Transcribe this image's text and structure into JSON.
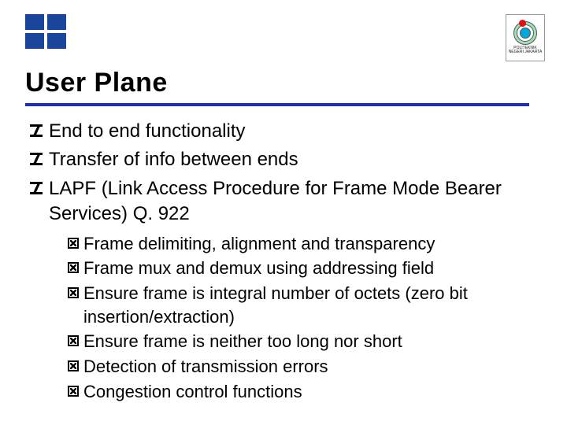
{
  "title": "User Plane",
  "logo_right_caption": "POLITEKNIK NEGERI JAKARTA",
  "bullets": [
    {
      "text": "End to end functionality"
    },
    {
      "text": "Transfer of info between ends"
    },
    {
      "text": "LAPF (Link Access Procedure for Frame Mode Bearer Services) Q. 922",
      "sub": [
        "Frame delimiting, alignment and transparency",
        "Frame mux and demux using addressing field",
        "Ensure frame is integral number of octets (zero bit insertion/extraction)",
        "Ensure frame is neither too long nor short",
        "Detection of transmission errors",
        "Congestion control functions"
      ]
    }
  ]
}
